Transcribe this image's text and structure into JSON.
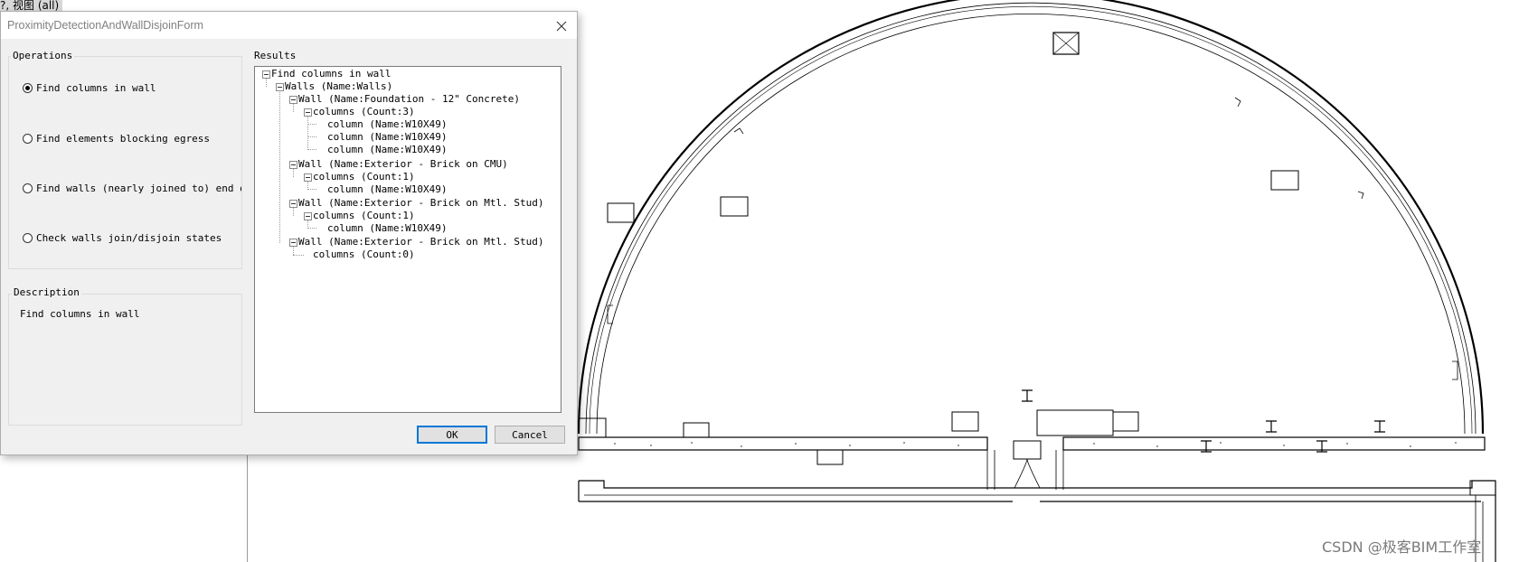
{
  "view_tab": {
    "label": "?, 视图 (all)"
  },
  "dialog": {
    "title": "ProximityDetectionAndWallDisjoinForm",
    "operations": {
      "label": "Operations",
      "options": [
        {
          "label": "Find columns in wall",
          "selected": true
        },
        {
          "label": "Find elements blocking egress",
          "selected": false
        },
        {
          "label": "Find walls (nearly joined to) end of",
          "selected": false
        },
        {
          "label": "Check walls join/disjoin states",
          "selected": false
        }
      ]
    },
    "description": {
      "label": "Description",
      "text": "Find columns in wall"
    },
    "results": {
      "label": "Results",
      "tree": [
        {
          "text": "Find columns in wall"
        },
        {
          "text": "Walls (Name:Walls)"
        },
        {
          "text": "Wall (Name:Foundation - 12\" Concrete)"
        },
        {
          "text": "columns (Count:3)"
        },
        {
          "text": "column (Name:W10X49)"
        },
        {
          "text": "column (Name:W10X49)"
        },
        {
          "text": "column (Name:W10X49)"
        },
        {
          "text": "Wall (Name:Exterior - Brick on CMU)"
        },
        {
          "text": "columns (Count:1)"
        },
        {
          "text": "column (Name:W10X49)"
        },
        {
          "text": "Wall (Name:Exterior - Brick on Mtl. Stud)"
        },
        {
          "text": "columns (Count:1)"
        },
        {
          "text": "column (Name:W10X49)"
        },
        {
          "text": "Wall (Name:Exterior - Brick on Mtl. Stud)"
        },
        {
          "text": "columns (Count:0)"
        }
      ]
    },
    "buttons": {
      "ok": "OK",
      "cancel": "Cancel"
    }
  },
  "watermark": "CSDN @极客BIM工作室",
  "colors": {
    "dialog_bg": "#f0f0f0",
    "default_button_border": "#0078d7",
    "drawing_line": "#000000"
  }
}
